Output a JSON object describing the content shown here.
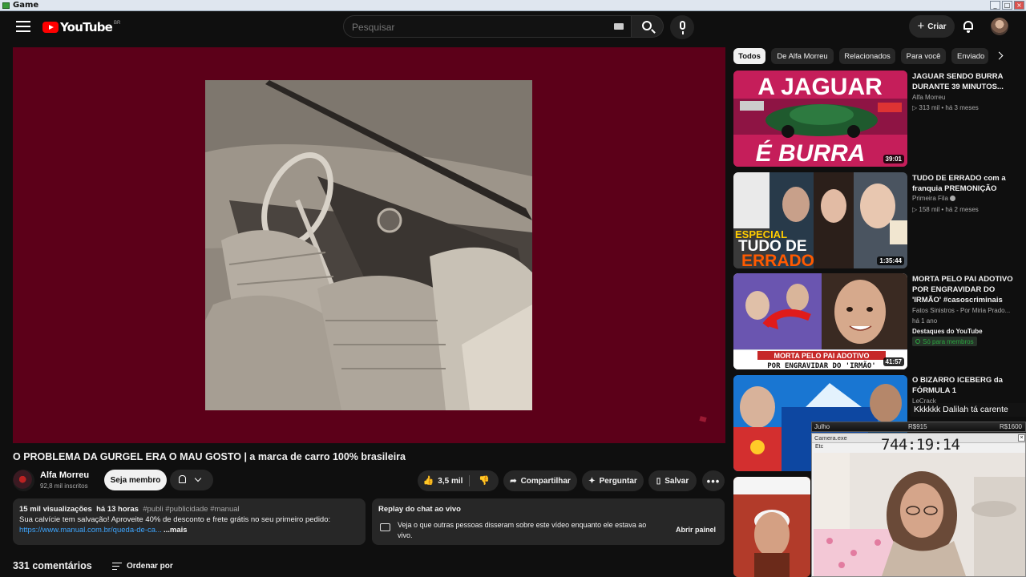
{
  "os": {
    "window_title": "Game"
  },
  "header": {
    "logo_text": "YouTube",
    "logo_region": "BR",
    "search_placeholder": "Pesquisar",
    "create_label": "Criar"
  },
  "video": {
    "title": "O PROBLEMA DA GURGEL ERA O MAU GOSTO | a marca de carro 100% brasileira",
    "channel_name": "Alfa Morreu",
    "subscribers": "92,8 mil inscritos",
    "join_label": "Seja membro",
    "likes": "3,5 mil",
    "share_label": "Compartilhar",
    "ask_label": "Perguntar",
    "save_label": "Salvar",
    "more_label": "•••"
  },
  "description": {
    "views": "15 mil visualizações",
    "time": "há 13 horas",
    "tags": "#publi #publicidade #manual",
    "line1": "Sua calvície tem salvação! Aproveite 40% de desconto e frete grátis no seu primeiro pedido:",
    "link": "https://www.manual.com.br/queda-de-ca...",
    "more_label": "...mais"
  },
  "chat_replay": {
    "title": "Replay do chat ao vivo",
    "description": "Veja o que outras pessoas disseram sobre este vídeo enquanto ele estava ao vivo.",
    "button_label": "Abrir painel"
  },
  "comments": {
    "count_label": "331 comentários",
    "sort_label": "Ordenar por"
  },
  "chips": [
    "Todos",
    "De Alfa Morreu",
    "Relacionados",
    "Para você",
    "Enviado"
  ],
  "recommended": [
    {
      "title": "JAGUAR SENDO BURRA DURANTE 39 MINUTOS...",
      "channel": "Alfa Morreu",
      "views": "313 mil",
      "age": "há 3 meses",
      "duration": "39:01",
      "thumb_text_top": "A JAGUAR",
      "thumb_text_bottom": "É BURRA"
    },
    {
      "title": "TUDO DE ERRADO com a franquia PREMONIÇÃO",
      "channel": "Primeira Fila",
      "views": "158 mil",
      "age": "há 2 meses",
      "duration": "1:35:44",
      "thumb_text_top": "ESPECIAL",
      "thumb_text_mid": "TUDO DE",
      "thumb_text_bottom": "ERRADO"
    },
    {
      "title": "MORTA PELO PAI ADOTIVO POR ENGRAVIDAR DO 'IRMÃO' #casoscriminais",
      "channel": "Fatos Sinistros - Por Miria Prado...",
      "age": "há 1 ano",
      "highlight": "Destaques do YouTube",
      "member_badge": "Só para membros",
      "duration": "41:57",
      "thumb_text_top": "MORTA PELO PAI ADOTIVO",
      "thumb_text_bottom": "POR ENGRAVIDAR DO 'IRMÃO'"
    },
    {
      "title": "O BIZARRO ICEBERG da FÓRMULA 1",
      "channel": "LeCrack"
    }
  ],
  "overlay": {
    "chat_message": "Kkkkkk Dalilah tá carente",
    "stream_user": "Julho",
    "stream_val1": "R$915",
    "stream_val2": "R$1600",
    "camera_title": "Camera.exe",
    "camera_menu": "Etc",
    "timer": "744:19:14"
  }
}
